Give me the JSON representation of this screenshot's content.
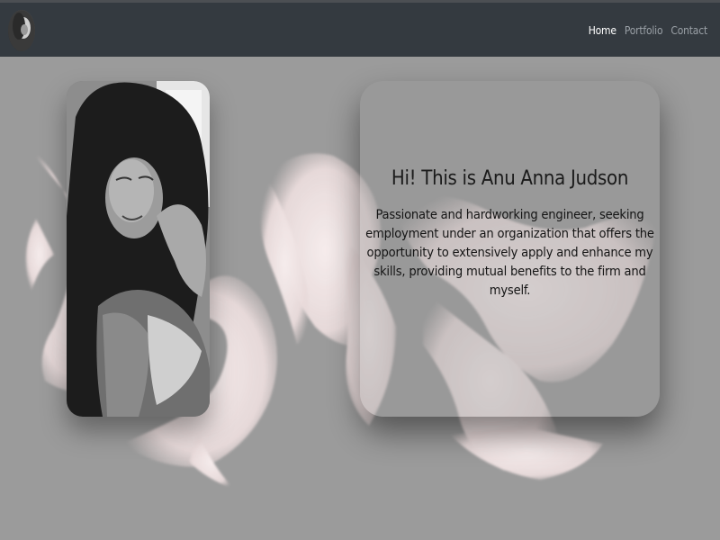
{
  "header": {
    "logo_icon": "profile-avatar-icon",
    "nav": [
      {
        "label": "Home",
        "active": true
      },
      {
        "label": "Portfolio",
        "active": false
      },
      {
        "label": "Contact",
        "active": false
      }
    ]
  },
  "main": {
    "intro_title": "Hi! This is Anu Anna Judson",
    "intro_text": "Passionate and hardworking engineer, seeking employment under an organization that offers the opportunity to extensively apply and enhance my skills, providing mutual benefits to the firm and myself."
  },
  "colors": {
    "header_bg": "#343a40",
    "page_bg": "#9b9b9b",
    "wing_color": "#f3e6e6",
    "nav_active": "#ffffff",
    "nav_inactive": "#9aa0a6"
  }
}
